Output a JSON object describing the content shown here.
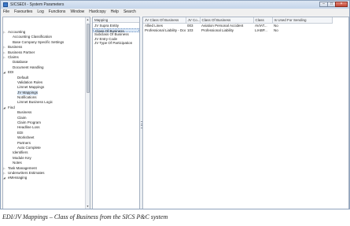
{
  "window": {
    "title": "SICSEDI - System Parameters",
    "min_glyph": "–",
    "max_glyph": "□",
    "close_glyph": "×"
  },
  "menubar": [
    "File",
    "Favourites",
    "Log",
    "Functions",
    "Window",
    "Hardcopy",
    "Help",
    "Search"
  ],
  "nav_tree": [
    {
      "label": "Accounting",
      "indent": 0,
      "arrow": "▷"
    },
    {
      "label": "Accounting Classification",
      "indent": 1,
      "arrow": ""
    },
    {
      "label": "Base Company Specific Settings",
      "indent": 1,
      "arrow": ""
    },
    {
      "label": "Business",
      "indent": 0,
      "arrow": "▷"
    },
    {
      "label": "Business Partner",
      "indent": 0,
      "arrow": "▷"
    },
    {
      "label": "Claims",
      "indent": 0,
      "arrow": "▷"
    },
    {
      "label": "Database",
      "indent": 1,
      "arrow": ""
    },
    {
      "label": "Document Handling",
      "indent": 1,
      "arrow": ""
    },
    {
      "label": "EDI",
      "indent": 0,
      "arrow": "◢"
    },
    {
      "label": "Default",
      "indent": 2,
      "arrow": ""
    },
    {
      "label": "Validation Rules",
      "indent": 2,
      "arrow": ""
    },
    {
      "label": "Limnet Mappings",
      "indent": 2,
      "arrow": ""
    },
    {
      "label": "JV Mappings",
      "indent": 2,
      "arrow": "",
      "selected": true
    },
    {
      "label": "Notifications",
      "indent": 2,
      "arrow": ""
    },
    {
      "label": "Limnet Business Logic",
      "indent": 2,
      "arrow": ""
    },
    {
      "label": "Find",
      "indent": 0,
      "arrow": "◢"
    },
    {
      "label": "Business",
      "indent": 2,
      "arrow": ""
    },
    {
      "label": "Claim",
      "indent": 2,
      "arrow": ""
    },
    {
      "label": "Claim Program",
      "indent": 2,
      "arrow": ""
    },
    {
      "label": "Headline Loss",
      "indent": 2,
      "arrow": ""
    },
    {
      "label": "EDI",
      "indent": 2,
      "arrow": ""
    },
    {
      "label": "Worksheet",
      "indent": 2,
      "arrow": ""
    },
    {
      "label": "Partners",
      "indent": 2,
      "arrow": ""
    },
    {
      "label": "Auto Complete",
      "indent": 2,
      "arrow": ""
    },
    {
      "label": "Identifiers",
      "indent": 1,
      "arrow": ""
    },
    {
      "label": "Module Key",
      "indent": 1,
      "arrow": ""
    },
    {
      "label": "Notes",
      "indent": 1,
      "arrow": ""
    },
    {
      "label": "Task Management",
      "indent": 0,
      "arrow": "▷"
    },
    {
      "label": "Underwriters Estimates",
      "indent": 0,
      "arrow": "▷"
    },
    {
      "label": "eMessaging",
      "indent": 0,
      "arrow": "◢"
    }
  ],
  "mapping_panel": {
    "header": "Mapping",
    "items": [
      {
        "label": "JV Supra Entity",
        "selected": false
      },
      {
        "label": "Class Of Business",
        "selected": true
      },
      {
        "label": "Subclass Of Business",
        "selected": false
      },
      {
        "label": "JV Entry Code",
        "selected": false
      },
      {
        "label": "JV Type Of Participation",
        "selected": false
      }
    ]
  },
  "grid": {
    "columns": [
      "JV Class Of Business",
      "JV Co...",
      "Class Of Business",
      "Class",
      "Is Used For Sending"
    ],
    "rows": [
      [
        "Allied Lines",
        "003",
        "Aviation Personal Accident",
        "AVIAT...",
        "No"
      ],
      [
        "Professional Liability - Doct...",
        "103",
        "Professional Liability",
        "LIABP...",
        "No"
      ]
    ]
  },
  "caption": "EDI/JV Mappings – Class of Business from the SICS P&C system",
  "icons": {
    "window": "app-icon",
    "scroll_up": "scroll-up-arrow-icon",
    "scroll_down": "scroll-down-arrow-icon",
    "splitter": "splitter-grip-icon"
  }
}
